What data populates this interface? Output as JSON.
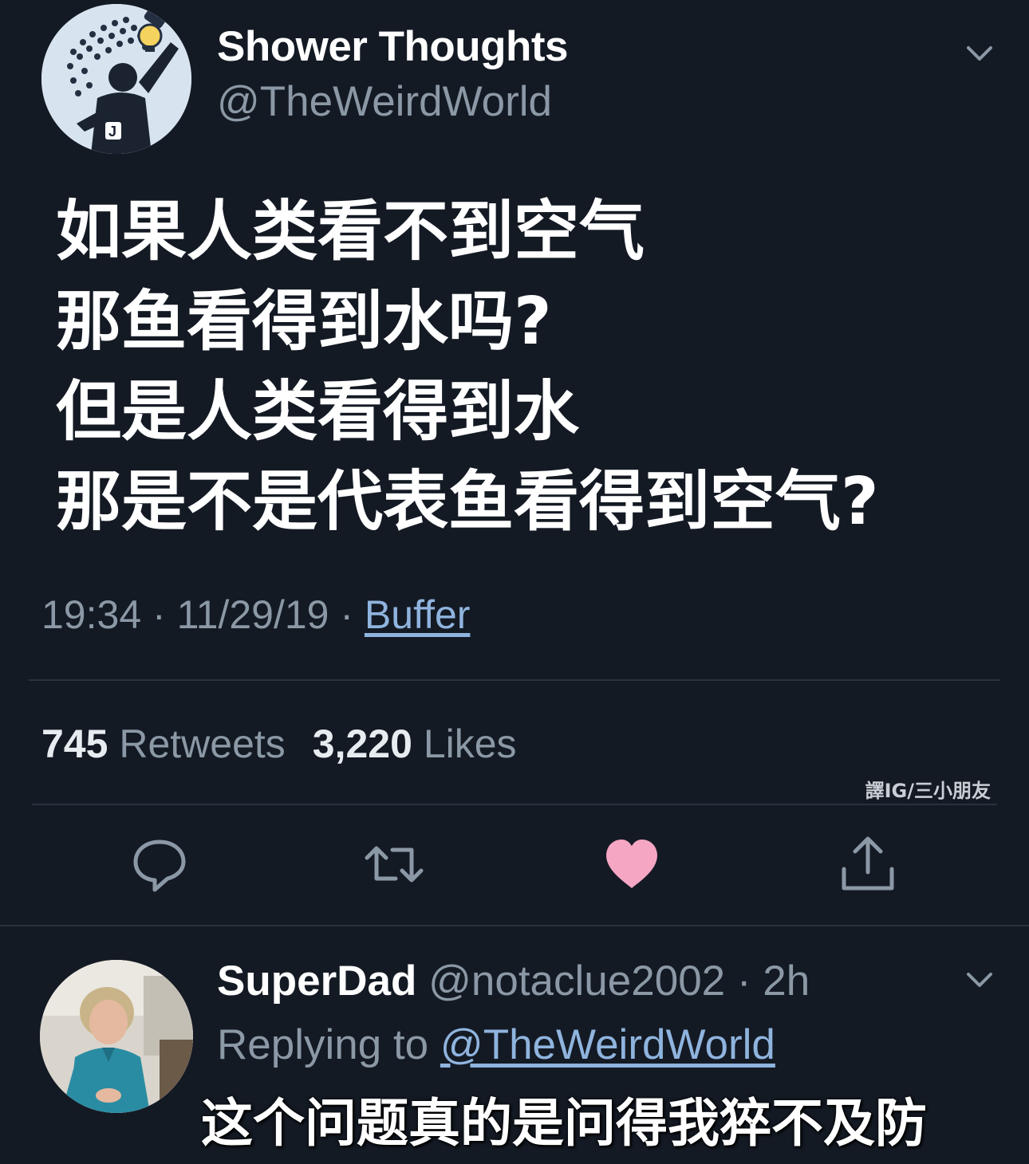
{
  "tweet": {
    "author_name": "Shower Thoughts",
    "author_handle": "@TheWeirdWorld",
    "text_lines": [
      "如果人类看不到空气",
      "那鱼看得到水吗?",
      "但是人类看得到水",
      "那是不是代表鱼看得到空气?"
    ],
    "time": "19:34",
    "date": "11/29/19",
    "source": "Buffer",
    "separator": " · ",
    "retweets_count": "745",
    "retweets_label": "Retweets",
    "likes_count": "3,220",
    "likes_label": "Likes",
    "liked": true
  },
  "watermark": "譯IG/三小朋友",
  "actions": [
    {
      "name": "reply",
      "icon": "speech-bubble-icon"
    },
    {
      "name": "retweet",
      "icon": "retweet-arrows-icon"
    },
    {
      "name": "like",
      "icon": "heart-icon",
      "color": "#f4a6c3"
    },
    {
      "name": "share",
      "icon": "share-upload-icon"
    }
  ],
  "reply": {
    "author_name": "SuperDad",
    "author_handle": "@notaclue2002",
    "time": "2h",
    "separator": " · ",
    "replying_prefix": "Replying to ",
    "replying_to": "@TheWeirdWorld",
    "caption": "这个问题真的是问得我猝不及防"
  },
  "colors": {
    "background": "#141a24",
    "muted_text": "#8b98a5",
    "link": "#8fb4de",
    "heart": "#f4a6c3"
  }
}
